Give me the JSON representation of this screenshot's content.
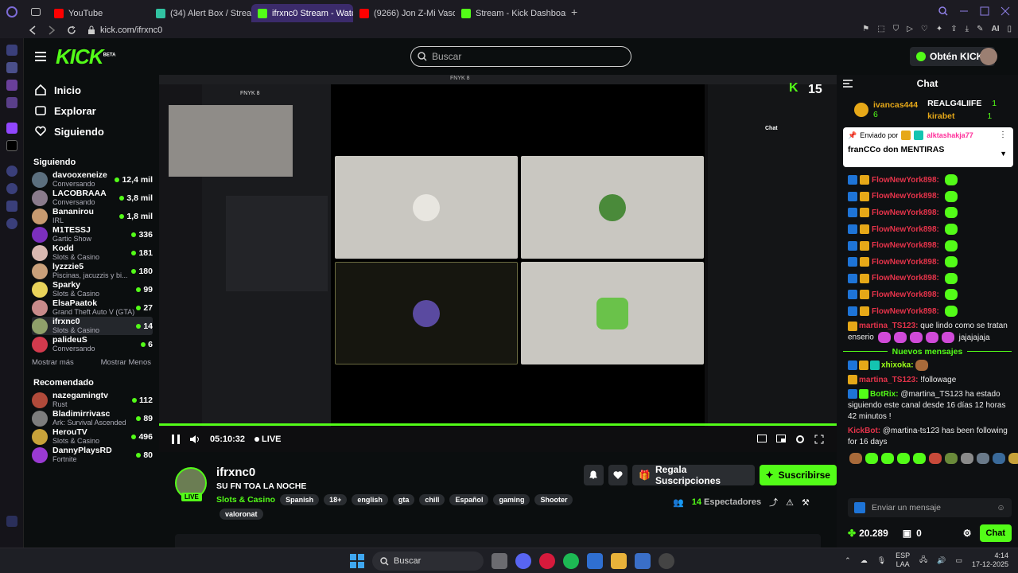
{
  "browser": {
    "tabs": [
      {
        "label": "YouTube",
        "color": "#ff0000",
        "active": false
      },
      {
        "label": "(34) Alert Box / Streamlab",
        "color": "#31c3a2",
        "active": false
      },
      {
        "label": "ifrxnc0 Stream - Watc",
        "color": "#53fc18",
        "active": true
      },
      {
        "label": "(9266) Jon Z-Mi Vaso Bla",
        "color": "#ff0000",
        "active": false
      },
      {
        "label": "Stream - Kick Dashboard",
        "color": "#53fc18",
        "active": false
      }
    ],
    "url": "kick.com/ifrxnc0",
    "ai_label": "AI"
  },
  "header": {
    "logo": "KICK",
    "logo_beta": "BETA",
    "search_placeholder": "Buscar",
    "kicks_button": "Obtén KICKs"
  },
  "nav": {
    "inicio": "Inicio",
    "explorar": "Explorar",
    "siguiendo": "Siguiendo"
  },
  "following": {
    "title": "Siguiendo",
    "channels": [
      {
        "name": "davooxeneize",
        "category": "Conversando",
        "viewers": "12,4 mil",
        "color": "#5b6f7e"
      },
      {
        "name": "LACOBRAAA",
        "category": "Conversando",
        "viewers": "3,8 mil",
        "color": "#8a7b8c"
      },
      {
        "name": "Bananirou",
        "category": "IRL",
        "viewers": "1,8 mil",
        "color": "#c79a70"
      },
      {
        "name": "M1TESSJ",
        "category": "Gartic Show",
        "viewers": "336",
        "color": "#7b2fbe"
      },
      {
        "name": "Kodd",
        "category": "Slots & Casino",
        "viewers": "181",
        "color": "#d8b8b0"
      },
      {
        "name": "lyzzzie5",
        "category": "Piscinas, jacuzzis y bi...",
        "viewers": "180",
        "color": "#c9a07a"
      },
      {
        "name": "Sparky",
        "category": "Slots & Casino",
        "viewers": "99",
        "color": "#e8d35a"
      },
      {
        "name": "ElsaPaatok",
        "category": "Grand Theft Auto V (GTA)",
        "viewers": "27",
        "color": "#c88b8b"
      },
      {
        "name": "ifrxnc0",
        "category": "Slots & Casino",
        "viewers": "14",
        "color": "#8fa06a"
      },
      {
        "name": "palideuS",
        "category": "Conversando",
        "viewers": "6",
        "color": "#d23a4d"
      }
    ],
    "show_more": "Mostrar más",
    "show_less": "Mostrar Menos"
  },
  "recommended": {
    "title": "Recomendado",
    "channels": [
      {
        "name": "nazegamingtv",
        "category": "Rust",
        "viewers": "112",
        "color": "#b04a3a"
      },
      {
        "name": "Bladimirrivasc",
        "category": "Ark: Survival Ascended",
        "viewers": "89",
        "color": "#7d7d7d"
      },
      {
        "name": "HerouTV",
        "category": "Slots & Casino",
        "viewers": "496",
        "color": "#c8a23a"
      },
      {
        "name": "DannyPlaysRD",
        "category": "Fortnite",
        "viewers": "80",
        "color": "#9a3ad2"
      }
    ]
  },
  "player": {
    "time": "05:10:32",
    "live_label": "LIVE",
    "progress": 1.0,
    "inner_window_title": "FNYK 8",
    "inner_server": "FNYK 8",
    "inner_kick_count": "15",
    "inner_chat_title": "Chat"
  },
  "stream": {
    "name": "ifrxnc0",
    "title": "SU FN TOA LA NOCHE",
    "category": "Slots & Casino",
    "tags": [
      "Spanish",
      "18+",
      "english",
      "gta",
      "chill",
      "Español",
      "gaming",
      "Shooter"
    ],
    "tag_extra": "valoronat",
    "live_badge": "LIVE",
    "gift_button": "Regala Suscripciones",
    "subscribe_button": "Suscribirse",
    "viewers_count": "14",
    "viewers_label": "Espectadores"
  },
  "chat": {
    "title": "Chat",
    "gifters": [
      {
        "name": "ivancas444",
        "count": "6"
      },
      {
        "name": "REALG4LIIFE",
        "count": "1"
      },
      {
        "name": "kirabet",
        "count": "1"
      }
    ],
    "pinned_by_label": "Enviado por",
    "pinned_user": "alktashakja77",
    "pinned_message": "franCCo don MENTIRAS",
    "repeat_user": "FlowNewYork898:",
    "repeat_count": 9,
    "messages": [
      {
        "user": "martina_TS123:",
        "text": "que lindo como se tratan enserio",
        "trail": "jajajajaja"
      },
      {
        "divider": "Nuevos mensajes"
      },
      {
        "user": "xhixoka:",
        "text": ""
      },
      {
        "user": "martina_TS123:",
        "text": "!followage"
      },
      {
        "user": "BotRix:",
        "text": "@martina_TS123 ha estado siguiendo este canal desde 16 días 12 horas 42 minutos !"
      },
      {
        "user": "KickBot:",
        "text": "@martina-ts123 has been following for 16 days"
      }
    ],
    "input_placeholder": "Enviar un mensaje",
    "points": "20.289",
    "gift_count": "0",
    "send_button": "Chat"
  },
  "taskbar": {
    "search": "Buscar",
    "lang": "ESP",
    "lang2": "LAA",
    "time": "4:14",
    "date": "17-12-2025"
  },
  "colors": {
    "accent": "#53fc18",
    "bg": "#0b0e0f"
  }
}
